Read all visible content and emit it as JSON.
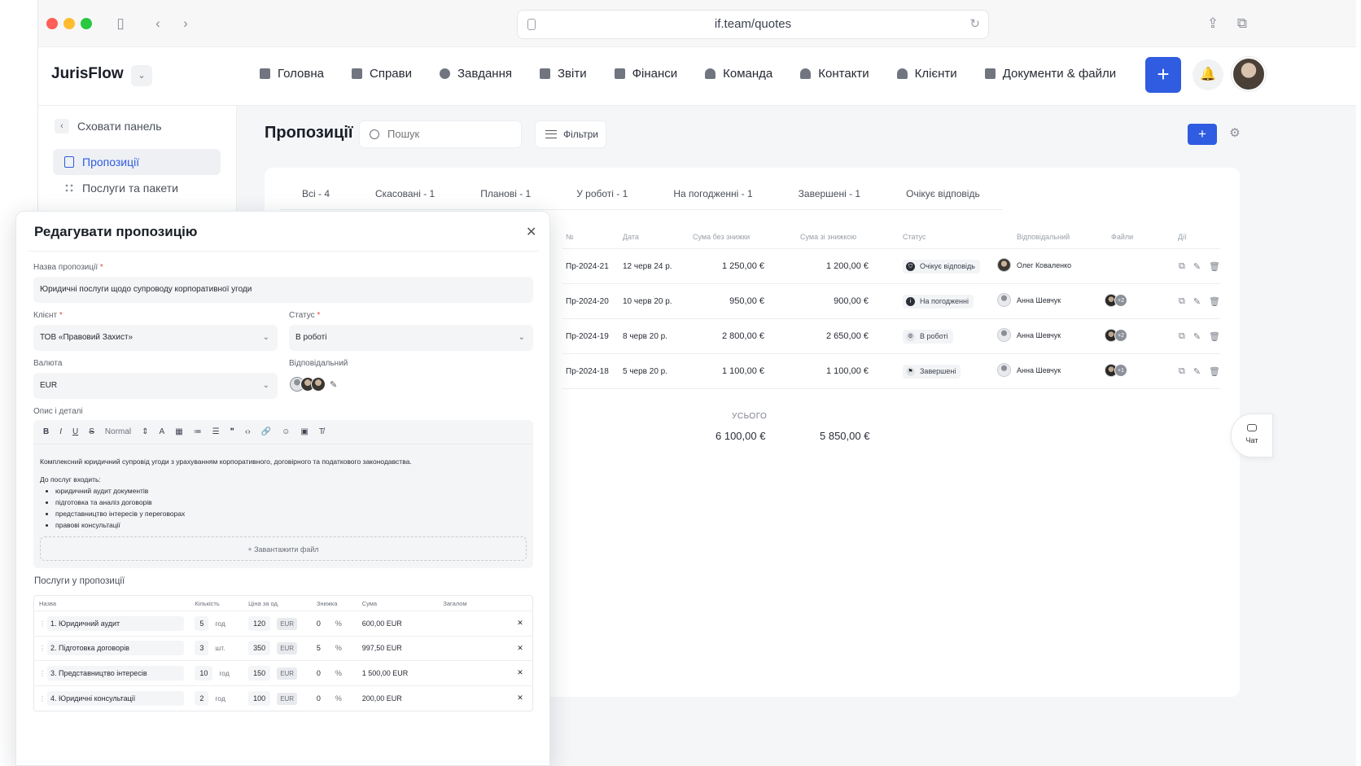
{
  "browser": {
    "url": "if.team/quotes"
  },
  "app": {
    "logo": "JurisFlow",
    "nav": [
      {
        "label": "Головна",
        "icon": "home-icon"
      },
      {
        "label": "Справи",
        "icon": "document-icon"
      },
      {
        "label": "Завдання",
        "icon": "check-circle-icon"
      },
      {
        "label": "Звіти",
        "icon": "report-icon"
      },
      {
        "label": "Фінанси",
        "icon": "calendar-icon"
      },
      {
        "label": "Команда",
        "icon": "user-icon"
      },
      {
        "label": "Контакти",
        "icon": "contacts-icon"
      },
      {
        "label": "Клієнти",
        "icon": "client-icon"
      },
      {
        "label": "Документи & файли",
        "icon": "files-icon"
      }
    ],
    "nav_more": "···",
    "plus": "+"
  },
  "sidebar": {
    "collapse_label": "Сховати панель",
    "items": [
      {
        "label": "Пропозиції",
        "icon": "document-icon",
        "active": true
      },
      {
        "label": "Послуги та пакети",
        "icon": "grid-icon",
        "active": false
      }
    ]
  },
  "main": {
    "title": "Пропозиції",
    "search_placeholder": "Пошук",
    "filters_label": "Фільтри",
    "tabs": [
      "Всі - 4",
      "Скасовані - 1",
      "Планові - 1",
      "У роботі - 1",
      "На погодженні - 1",
      "Завершені - 1",
      "Очікує відповідь"
    ],
    "columns": [
      "№",
      "Дата",
      "Сума без знижки",
      "Сума зі знижкою",
      "Статус",
      "Відповідальний",
      "Файли",
      "Дії"
    ],
    "rows": [
      {
        "num": "Пр-2024-21",
        "date": "12 черв 24 р.",
        "sum": "1 250,00 €",
        "discounted": "1 200,00 €",
        "status": "Очікує відповідь",
        "status_icon": "shield-icon",
        "owner": "Олег Коваленко",
        "files": ""
      },
      {
        "num": "Пр-2024-20",
        "date": "10 черв 20 р.",
        "sum": "950,00 €",
        "discounted": "900,00 €",
        "status": "На погодженні",
        "status_icon": "info-icon",
        "owner": "Анна Шевчук",
        "files": "+2"
      },
      {
        "num": "Пр-2024-19",
        "date": "8 черв 20 р.",
        "sum": "2 800,00 €",
        "discounted": "2 650,00 €",
        "status": "В роботі",
        "status_icon": "gear-icon",
        "owner": "Анна Шевчук",
        "files": "+2"
      },
      {
        "num": "Пр-2024-18",
        "date": "5 черв 20 р.",
        "sum": "1 100,00 €",
        "discounted": "1 100,00 €",
        "status": "Завершені",
        "status_icon": "flag-icon",
        "owner": "Анна Шевчук",
        "files": "+1"
      }
    ],
    "totals_label": "УСЬОГО",
    "total_sum": "6 100,00 €",
    "total_discounted": "5 850,00 €"
  },
  "chat_label": "Чат",
  "modal": {
    "title": "Редагувати пропозицію",
    "name_label": "Назва пропозиції",
    "name_value": "Юридичні послуги щодо супроводу корпоративної угоди",
    "client_label": "Клієнт",
    "client_value": "ТОВ «Правовий Захист»",
    "status_label": "Статус",
    "status_value": "В роботі",
    "currency_label": "Валюта",
    "currency_value": "EUR",
    "responsible_label": "Відповідальний",
    "description_label": "Опис і деталі",
    "toolbar_format": "Normal",
    "description_text": "Комплексний юридичний супровід угоди з урахуванням корпоративного, договірного та податкового законодавства.",
    "description_list_title": "До послуг входить:",
    "description_list": [
      "юридичний аудит документів",
      "підготовка та аналіз договорів",
      "представництво інтересів у переговорах",
      "правові консультації"
    ],
    "upload_label": "+ Завантажити файл",
    "services_title": "Послуги у пропозиції",
    "services_columns": [
      "Назва",
      "Кількість",
      "Ціна за од.",
      "Знижка",
      "Сума",
      "Загалом"
    ],
    "services": [
      {
        "name": "1.  Юридичний аудит",
        "qty": "5",
        "unit": "год",
        "price": "120",
        "currency": "EUR",
        "discount": "0",
        "pct": "%",
        "sum": "600,00 EUR"
      },
      {
        "name": "2.  Підготовка договорів",
        "qty": "3",
        "unit": "шт.",
        "price": "350",
        "currency": "EUR",
        "discount": "5",
        "pct": "%",
        "sum": "997,50 EUR"
      },
      {
        "name": "3.  Представництво інтересів",
        "qty": "10",
        "unit": "год",
        "price": "150",
        "currency": "EUR",
        "discount": "0",
        "pct": "%",
        "sum": "1 500,00 EUR"
      },
      {
        "name": "4.  Юридичні консультації",
        "qty": "2",
        "unit": "год",
        "price": "100",
        "currency": "EUR",
        "discount": "0",
        "pct": "%",
        "sum": "200,00 EUR"
      }
    ]
  },
  "colors": {
    "accent": "#2f5ce0",
    "required": "#e04848"
  }
}
